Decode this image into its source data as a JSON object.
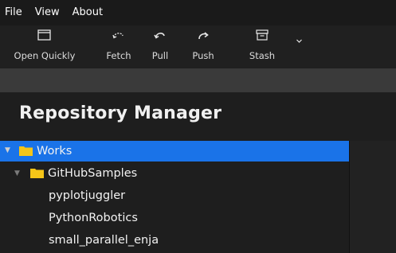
{
  "menu": {
    "file": "File",
    "view": "View",
    "about": "About"
  },
  "toolbar": {
    "open_quickly": "Open Quickly",
    "fetch": "Fetch",
    "pull": "Pull",
    "push": "Push",
    "stash": "Stash"
  },
  "page": {
    "title": "Repository Manager"
  },
  "tree": {
    "root": "Works",
    "group": "GitHubSamples",
    "repos": [
      "pyplotjuggler",
      "PythonRobotics",
      "small_parallel_enja"
    ]
  },
  "colors": {
    "selection": "#1a73e8",
    "folder": "#f5c518"
  }
}
